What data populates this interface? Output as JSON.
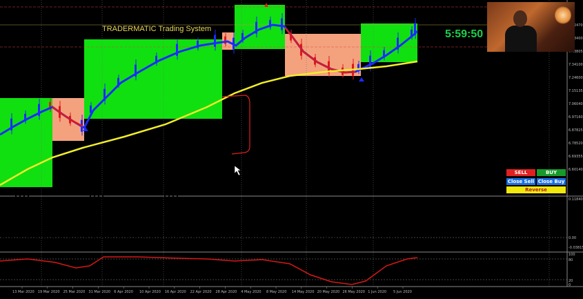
{
  "window": {
    "title": "TRADERMATIC Trading System",
    "timer": "5:59:50"
  },
  "chart_data": {
    "type": "candlestick-indicator",
    "price_axis_labels": [
      "7.62470",
      "7.53400",
      "7.43805",
      "7.34100",
      "7.24600",
      "7.15135",
      "7.06040",
      "6.97160",
      "6.87825",
      "6.78520",
      "6.69355",
      "6.60140"
    ],
    "oscillator_axis_labels": [
      "0.118400",
      "0.00",
      "-0.03815"
    ],
    "rsi_axis_labels": [
      "100",
      "80",
      "20",
      "0"
    ],
    "dates": [
      "13 Mar 2020",
      "19 Mar 2020",
      "25 Mar 2020",
      "31 Mar 2020",
      "6 Apr 2020",
      "10 Apr 2020",
      "16 Apr 2020",
      "22 Apr 2020",
      "28 Apr 2020",
      "4 May 2020",
      "8 May 2020",
      "14 May 2020",
      "20 May 2020",
      "26 May 2020",
      "1 Jun 2020",
      "5 Jun 2020"
    ],
    "colors": {
      "buy_zone": "#10e010",
      "sell_zone": "#f4a27e",
      "trend_line": "#1a2cff",
      "sell_trend_line": "#e01818",
      "ma_line": "#f1ee2a",
      "osc_up": "#1c2cc0",
      "osc_pos": "#ece07a",
      "osc_neg": "#e01818",
      "rsi_line": "#d81818"
    }
  },
  "trade_panel": {
    "sell": "SELL",
    "buy": "BUY",
    "close_sell": "Close Sell",
    "close_buy": "Close Buy",
    "reverse": "Reverse"
  }
}
